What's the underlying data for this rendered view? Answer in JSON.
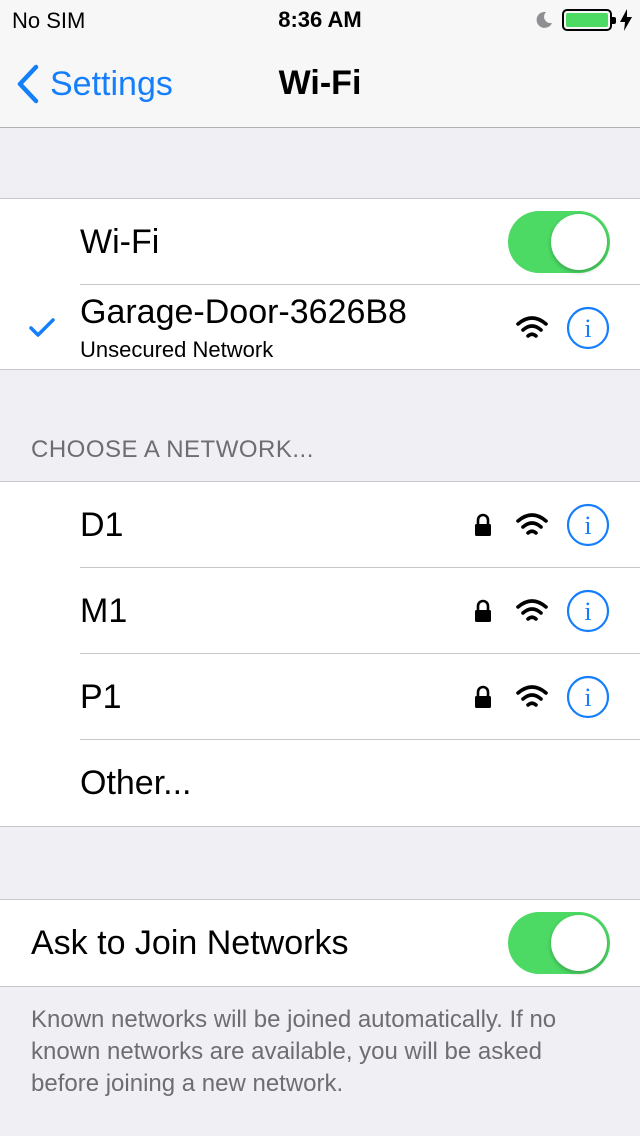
{
  "status_bar": {
    "carrier": "No SIM",
    "time": "8:36 AM",
    "battery_color": "#4cd964"
  },
  "nav": {
    "back_label": "Settings",
    "title": "Wi-Fi",
    "accent_color": "#147efb"
  },
  "wifi_toggle": {
    "label": "Wi-Fi",
    "on": true
  },
  "connected_network": {
    "name": "Garage-Door-3626B8",
    "subtitle": "Unsecured Network",
    "icons": [
      "checkmark-icon",
      "wifi-signal-icon",
      "info-icon"
    ]
  },
  "choose_header": "CHOOSE A NETWORK...",
  "networks": [
    {
      "name": "D1",
      "secured": true
    },
    {
      "name": "M1",
      "secured": true
    },
    {
      "name": "P1",
      "secured": true
    }
  ],
  "other_label": "Other...",
  "ask_to_join": {
    "label": "Ask to Join Networks",
    "on": true,
    "footer": "Known networks will be joined automatically. If no known networks are available, you will be asked before joining a new network."
  }
}
